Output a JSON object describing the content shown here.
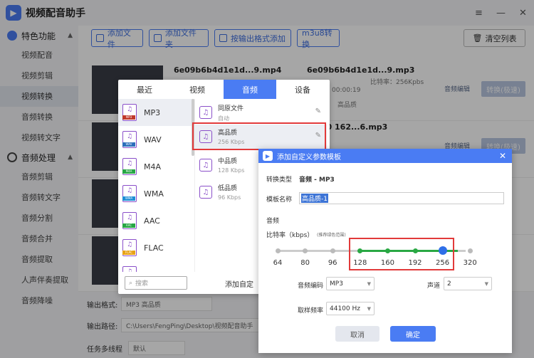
{
  "app": {
    "title": "视频配音助手",
    "logo_icon": "app-logo-icon"
  },
  "window_controls": [
    "≡",
    "—",
    "✕"
  ],
  "sidebar": {
    "sections": [
      {
        "label": "特色功能",
        "items": [
          "视频配音",
          "视频剪辑",
          "视频转换",
          "音频转换",
          "视频转文字"
        ]
      },
      {
        "label": "音频处理",
        "items": [
          "音频剪辑",
          "音频转文字",
          "音频分割",
          "音频合并",
          "音频提取",
          "人声伴奏提取",
          "音频降噪"
        ]
      }
    ],
    "active_item": "视频转换"
  },
  "toolbar": {
    "add_file": "添加文件",
    "add_folder": "添加文件夹",
    "add_by_format": "按输出格式添加",
    "m3u8": "m3u8转换",
    "clear_list": "清空列表"
  },
  "files": [
    {
      "source": "6e09b6b4d1e1d...9.mp4",
      "output": "6e09b6b4d1e1d...9.mp3",
      "bitrate": "比特率：256Kpbs",
      "duration": "00:00:19",
      "quality": "高品质",
      "edit": "音频编辑",
      "convert": "转换(极速)"
    },
    {
      "output": "07-20 162...6.mp3",
      "edit": "音频编辑",
      "convert": "转换(极速)"
    }
  ],
  "bottom": {
    "output_format_label": "输出格式:",
    "output_format_value": "MP3  高品质",
    "output_path_label": "输出路径:",
    "output_path_value": "C:\\Users\\FengPing\\Desktop\\视频配音助手",
    "multithread_label": "任务多线程",
    "multithread_value": "默认"
  },
  "format_panel": {
    "tabs": [
      "最近",
      "视频",
      "音频",
      "设备"
    ],
    "active_tab": "音频",
    "formats": [
      "MP3",
      "WAV",
      "M4A",
      "WMA",
      "AAC",
      "FLAC",
      "AC3"
    ],
    "format_tags": [
      "MP3",
      "WAV",
      "M4A",
      "WMA",
      "AAC",
      "FLAC",
      "AC3"
    ],
    "tag_colors": [
      "#c0392b",
      "#2c6fbb",
      "#27a745",
      "#1f8fd6",
      "#27a745",
      "#e8a317",
      "#8a4fc9"
    ],
    "qualities": [
      {
        "name": "同原文件",
        "sub": "自动"
      },
      {
        "name": "高品质",
        "sub": "256 Kbps"
      },
      {
        "name": "中品质",
        "sub": "128 Kbps"
      },
      {
        "name": "低品质",
        "sub": "96 Kbps"
      }
    ],
    "search_placeholder": "搜索",
    "add_custom": "添加自定"
  },
  "dialog": {
    "title": "添加自定义参数模板",
    "convert_type_label": "转换类型",
    "convert_type_value": "音频 - MP3",
    "template_name_label": "模板名称",
    "template_name_value": "高品质-1",
    "audio_section": "音频",
    "bitrate_label": "比特率（kbps）",
    "bitrate_hint": "(推荐绿色范围)",
    "ticks": [
      "64",
      "80",
      "96",
      "128",
      "160",
      "192",
      "256",
      "320"
    ],
    "selected_bitrate": "256",
    "encoder_label": "音频编码",
    "encoder_value": "MP3",
    "channel_label": "声道",
    "channel_value": "2",
    "samplerate_label": "取样频率",
    "samplerate_value": "44100 Hz",
    "cancel": "取消",
    "ok": "确定"
  }
}
